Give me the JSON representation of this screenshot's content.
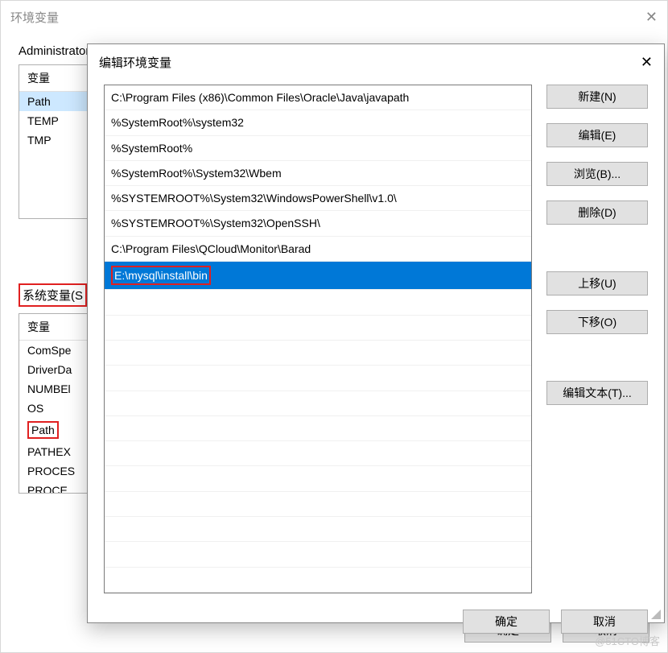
{
  "parent_dialog": {
    "title": "环境变量",
    "user_section_label": "Administrator",
    "user_vars_header": "变量",
    "user_vars": [
      {
        "name": "Path",
        "selected": true
      },
      {
        "name": "TEMP",
        "selected": false
      },
      {
        "name": "TMP",
        "selected": false
      }
    ],
    "system_section_label": "系统变量(S",
    "system_vars_header": "变量",
    "system_vars": [
      {
        "name": "ComSpe"
      },
      {
        "name": "DriverDa"
      },
      {
        "name": "NUMBEl"
      },
      {
        "name": "OS"
      },
      {
        "name": "Path",
        "red": true
      },
      {
        "name": "PATHEX"
      },
      {
        "name": "PROCES"
      },
      {
        "name": "PROCE"
      }
    ],
    "ok_label": "确定",
    "cancel_label": "取消"
  },
  "edit_dialog": {
    "title": "编辑环境变量",
    "paths": [
      {
        "text": "C:\\Program Files (x86)\\Common Files\\Oracle\\Java\\javapath",
        "selected": false
      },
      {
        "text": "%SystemRoot%\\system32",
        "selected": false
      },
      {
        "text": "%SystemRoot%",
        "selected": false
      },
      {
        "text": "%SystemRoot%\\System32\\Wbem",
        "selected": false
      },
      {
        "text": "%SYSTEMROOT%\\System32\\WindowsPowerShell\\v1.0\\",
        "selected": false
      },
      {
        "text": "%SYSTEMROOT%\\System32\\OpenSSH\\",
        "selected": false
      },
      {
        "text": "C:\\Program Files\\QCloud\\Monitor\\Barad",
        "selected": false
      },
      {
        "text": "E:\\mysql\\install\\bin",
        "selected": true
      }
    ],
    "buttons": {
      "new": "新建(N)",
      "edit": "编辑(E)",
      "browse": "浏览(B)...",
      "delete": "删除(D)",
      "move_up": "上移(U)",
      "move_down": "下移(O)",
      "edit_text": "编辑文本(T)..."
    },
    "ok_label": "确定",
    "cancel_label": "取消"
  },
  "watermark": "@51CTO博客"
}
